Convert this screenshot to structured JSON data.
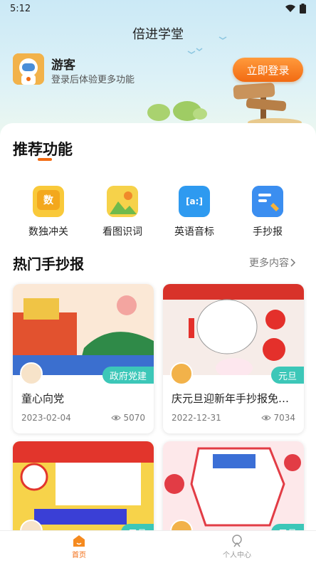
{
  "status_bar": {
    "time": "5:12"
  },
  "header": {
    "title": "倍进学堂",
    "user_name": "游客",
    "user_sub": "登录后体验更多功能",
    "login_label": "立即登录"
  },
  "recommend": {
    "title": "推荐功能",
    "items": [
      {
        "label": "数独冲关",
        "icon": "sudoku-icon",
        "glyph": "数"
      },
      {
        "label": "看图识词",
        "icon": "picture-icon"
      },
      {
        "label": "英语音标",
        "icon": "phonetic-icon",
        "glyph": "[a:]"
      },
      {
        "label": "手抄报",
        "icon": "handwritten-report-icon"
      }
    ]
  },
  "hot": {
    "title": "热门手抄报",
    "more_label": "更多内容",
    "cards": [
      {
        "title": "童心向党",
        "tag": "政府党建",
        "date": "2023-02-04",
        "views": "5070"
      },
      {
        "title": "庆元旦迎新年手抄报免费下载",
        "tag": "元旦",
        "date": "2022-12-31",
        "views": "7034"
      },
      {
        "title": "",
        "tag": "元旦",
        "date": "",
        "views": ""
      },
      {
        "title": "",
        "tag": "元旦",
        "date": "",
        "views": ""
      }
    ]
  },
  "tabs": [
    {
      "label": "首页",
      "active": true
    },
    {
      "label": "个人中心",
      "active": false
    }
  ],
  "colors": {
    "accent": "#f26b12",
    "tag": "#3cc7b8"
  }
}
